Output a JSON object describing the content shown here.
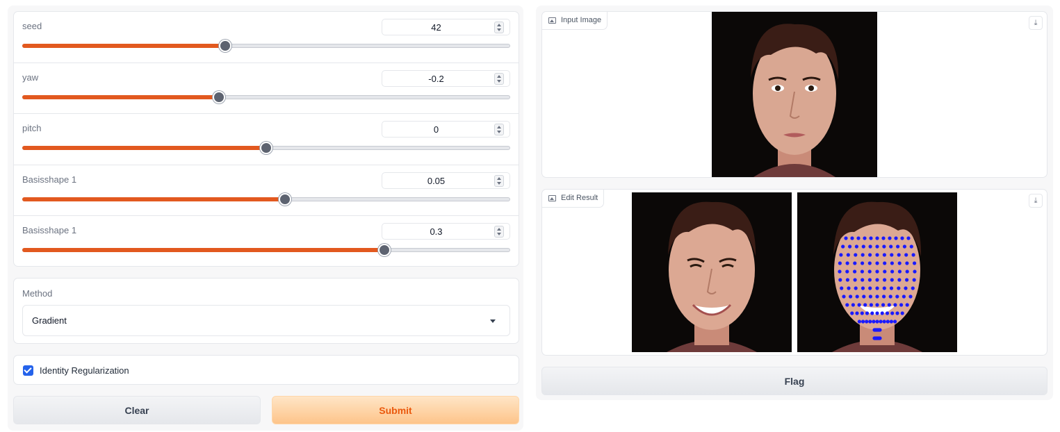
{
  "sliders": [
    {
      "label": "seed",
      "value": "42",
      "fill": 0.415
    },
    {
      "label": "yaw",
      "value": "-0.2",
      "fill": 0.403
    },
    {
      "label": "pitch",
      "value": "0",
      "fill": 0.5
    },
    {
      "label": "Basisshape 1",
      "value": "0.05",
      "fill": 0.539
    },
    {
      "label": "Basisshape 1",
      "value": "0.3",
      "fill": 0.743
    }
  ],
  "method": {
    "label": "Method",
    "value": "Gradient"
  },
  "identity": {
    "label": "Identity Regularization",
    "checked": true
  },
  "buttons": {
    "clear": "Clear",
    "submit": "Submit",
    "flag": "Flag"
  },
  "input_image": {
    "label": "Input Image"
  },
  "edit_result": {
    "label": "Edit Result"
  },
  "icons": {
    "download": "download-icon",
    "image": "image-icon",
    "dropdown": "chevron-down-icon",
    "check": "check-icon"
  },
  "colors": {
    "accent": "#e2591f",
    "checkbox": "#2563eb",
    "landmarks": "#1a1aff"
  }
}
